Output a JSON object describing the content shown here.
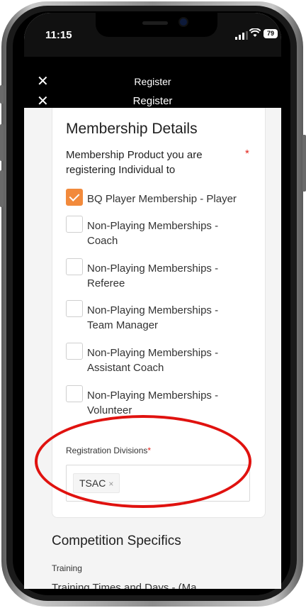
{
  "status_bar": {
    "time": "11:15",
    "battery": "79"
  },
  "header": {
    "close_icon": "close-icon",
    "title_1": "Register",
    "title_2": "Register"
  },
  "membership": {
    "title": "Membership Details",
    "question": "Membership Product you are registering Individual to",
    "required_mark": "*",
    "options": [
      {
        "label": "BQ Player Membership - Player",
        "checked": true
      },
      {
        "label": "Non-Playing Memberships - Coach",
        "checked": false
      },
      {
        "label": "Non-Playing Memberships - Referee",
        "checked": false
      },
      {
        "label": "Non-Playing Memberships - Team Manager",
        "checked": false
      },
      {
        "label": "Non-Playing Memberships - Assistant Coach",
        "checked": false
      },
      {
        "label": "Non-Playing Memberships - Volunteer",
        "checked": false
      }
    ],
    "divisions_label": "Registration Divisions",
    "divisions_required": "*",
    "selected_division": "TSAC",
    "tag_remove": "×"
  },
  "competition": {
    "title": "Competition Specifics",
    "training_label": "Training",
    "next_text": "Training Times and Days - (Ma..."
  },
  "colors": {
    "accent": "#f28a3c",
    "required": "#e2231a",
    "annotation": "#e0120f"
  }
}
